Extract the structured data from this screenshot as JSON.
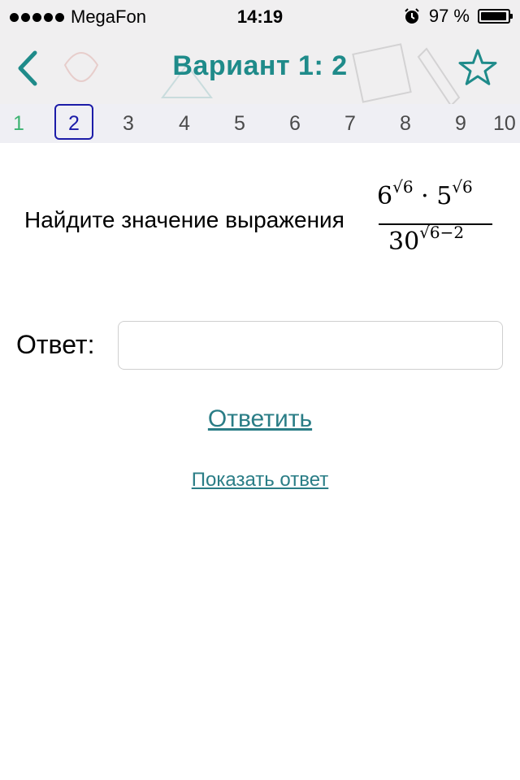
{
  "status_bar": {
    "carrier": "MegaFon",
    "time": "14:19",
    "battery_percent": "97 %",
    "battery_level": 0.97,
    "icons": [
      "signal-dots-icon",
      "alarm-icon",
      "battery-icon"
    ]
  },
  "header": {
    "title": "Вариант 1: 2",
    "back_icon": "chevron-left-icon",
    "favorite_icon": "star-outline-icon",
    "accent_color": "#1f8b8a"
  },
  "number_strip": {
    "items": [
      "1",
      "2",
      "3",
      "4",
      "5",
      "6",
      "7",
      "8",
      "9",
      "10"
    ],
    "active_index": 1,
    "done_color": "#3cb371",
    "active_color": "#1c1ca8"
  },
  "question": {
    "text": "Найдите значение выражения",
    "formula": {
      "num_base1": "6",
      "num_exp1": "√6",
      "dot": "·",
      "num_base2": "5",
      "num_exp2": "√6",
      "den_base": "30",
      "den_exp": "√6−2"
    }
  },
  "answer": {
    "label": "Ответ:",
    "value": "",
    "placeholder": ""
  },
  "actions": {
    "submit_label": "Ответить",
    "show_answer_label": "Показать ответ",
    "link_color": "#2a7d86"
  }
}
